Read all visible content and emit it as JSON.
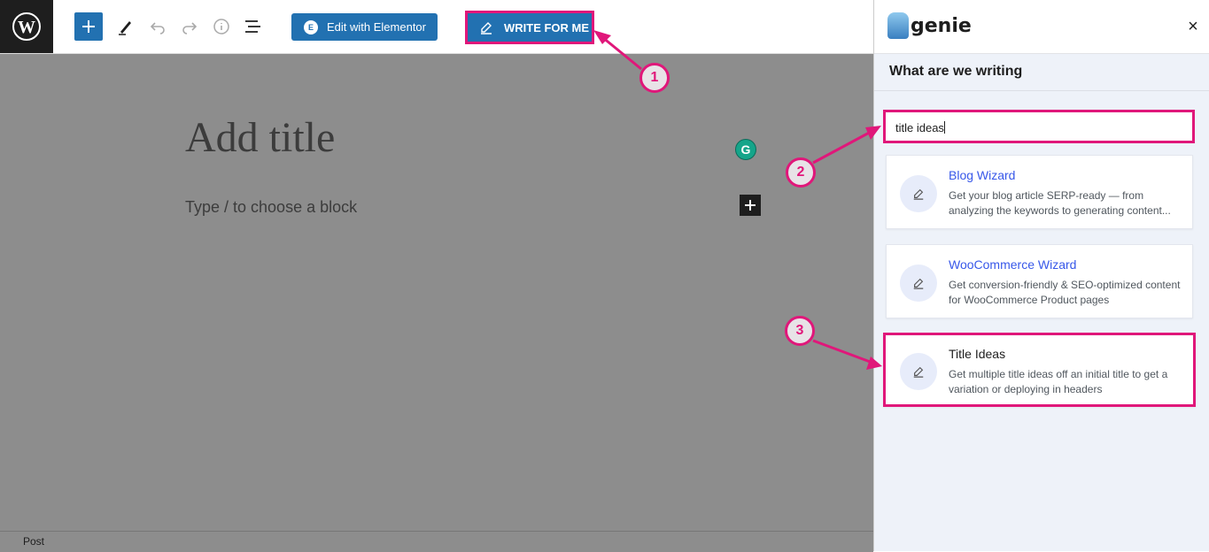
{
  "toolbar": {
    "elementor_label": "Edit with Elementor",
    "write_label": "WRITE FOR ME"
  },
  "editor": {
    "title_placeholder": "Add title",
    "block_placeholder": "Type / to choose a block",
    "footer_label": "Post"
  },
  "sidebar": {
    "logo_text": "genie",
    "close_glyph": "×",
    "section_title": "What are we writing",
    "search_value": "title ideas",
    "cards": [
      {
        "title": "Blog Wizard",
        "desc": "Get your blog article SERP-ready — from analyzing the keywords to generating content..."
      },
      {
        "title": "WooCommerce Wizard",
        "desc": "Get conversion-friendly & SEO-optimized content for WooCommerce Product pages"
      },
      {
        "title": "Title Ideas",
        "desc": "Get multiple title ideas off an initial title to get a variation or deploying in headers"
      }
    ]
  },
  "callouts": [
    "1",
    "2",
    "3"
  ],
  "icons": [
    "wordpress-logo-icon",
    "plus-icon",
    "pen-icon",
    "undo-icon",
    "redo-icon",
    "info-icon",
    "list-view-icon",
    "elementor-icon",
    "pencil-icon",
    "grammarly-icon",
    "close-icon"
  ],
  "colors": {
    "accent": "#2271b1",
    "highlight": "#e0177a",
    "link": "#3858e9"
  }
}
